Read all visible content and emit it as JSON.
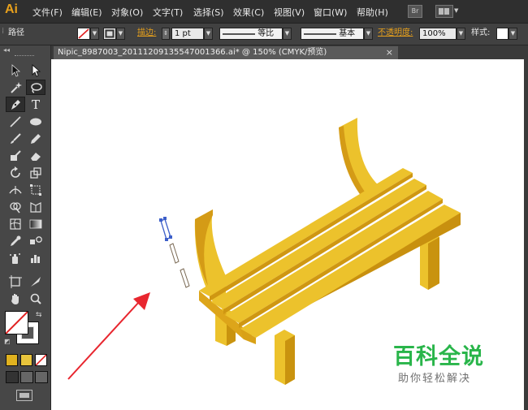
{
  "app": {
    "logo": "Ai"
  },
  "menu": [
    "文件(F)",
    "编辑(E)",
    "对象(O)",
    "文字(T)",
    "选择(S)",
    "效果(C)",
    "视图(V)",
    "窗口(W)",
    "帮助(H)"
  ],
  "menu_icons": {
    "bridge": "Br",
    "arrange": "arrange-documents-icon"
  },
  "control_bar": {
    "selection_label": "路径",
    "stroke_label": "描边:",
    "stroke_weight": "1 pt",
    "profile_label": "等比",
    "brush_label": "基本",
    "opacity_label": "不透明度:",
    "opacity_value": "100%",
    "style_label": "样式:"
  },
  "document_tab": {
    "title": "Nipic_8987003_20111209135547001366.ai* @ 150% (CMYK/预览)",
    "close": "×"
  },
  "watermark": {
    "title": "百科全说",
    "subtitle": "助你轻松解决"
  },
  "colors": {
    "accent": "#e7a01c",
    "bench_top": "#ecc22c",
    "bench_side": "#d49b16",
    "bench_dark": "#b8820f",
    "arrow": "#e8262f",
    "watermark_green": "#29b54a"
  }
}
